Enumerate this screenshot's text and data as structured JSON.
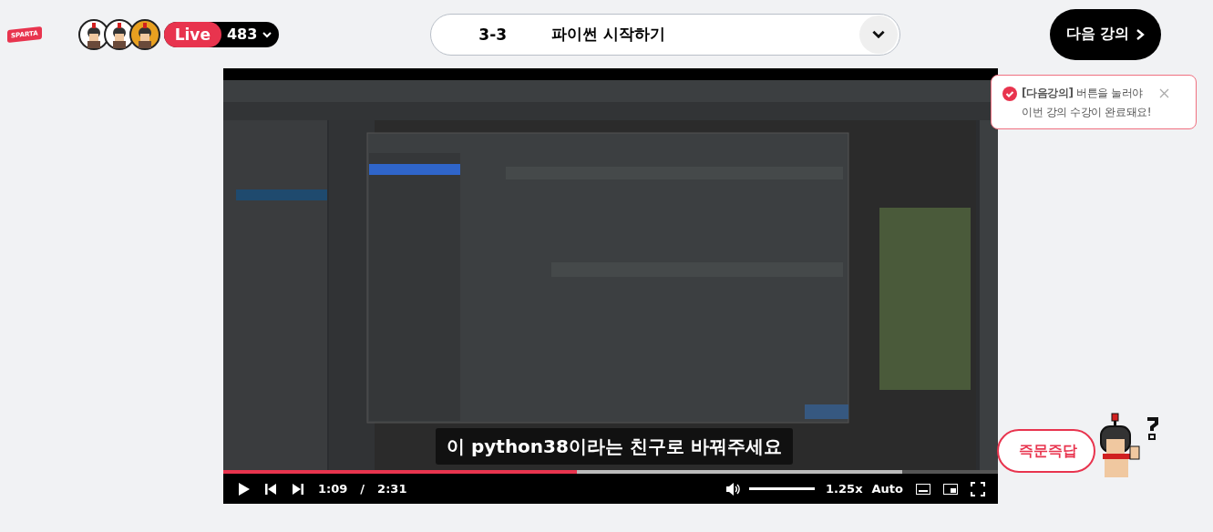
{
  "header": {
    "logo": "SPARTA",
    "live": {
      "label": "Live",
      "count": "483",
      "avatars": [
        {
          "kind": "avatar"
        },
        {
          "kind": "avatar"
        },
        {
          "kind": "avatar"
        }
      ]
    },
    "lecture": {
      "number": "3-3",
      "title": "파이썬 시작하기"
    },
    "next_button": "다음 강의"
  },
  "tooltip": {
    "lines": [
      "**[다음강의]** 버튼을 눌러야",
      "이번 강의 수강이 완료돼요!"
    ]
  },
  "video": {
    "kind": "picture",
    "subtitle": "이 python38이라는 친구로 바꿔주세요",
    "progress": {
      "level": 0.456
    },
    "buffer": {
      "level": 0.876
    },
    "current_time": "1:09",
    "time_separator": "/",
    "duration": "2:31",
    "volume": {
      "level": 1
    },
    "speed": "1.25x",
    "quality": "Auto"
  },
  "qa_button": "즉문즉답"
}
